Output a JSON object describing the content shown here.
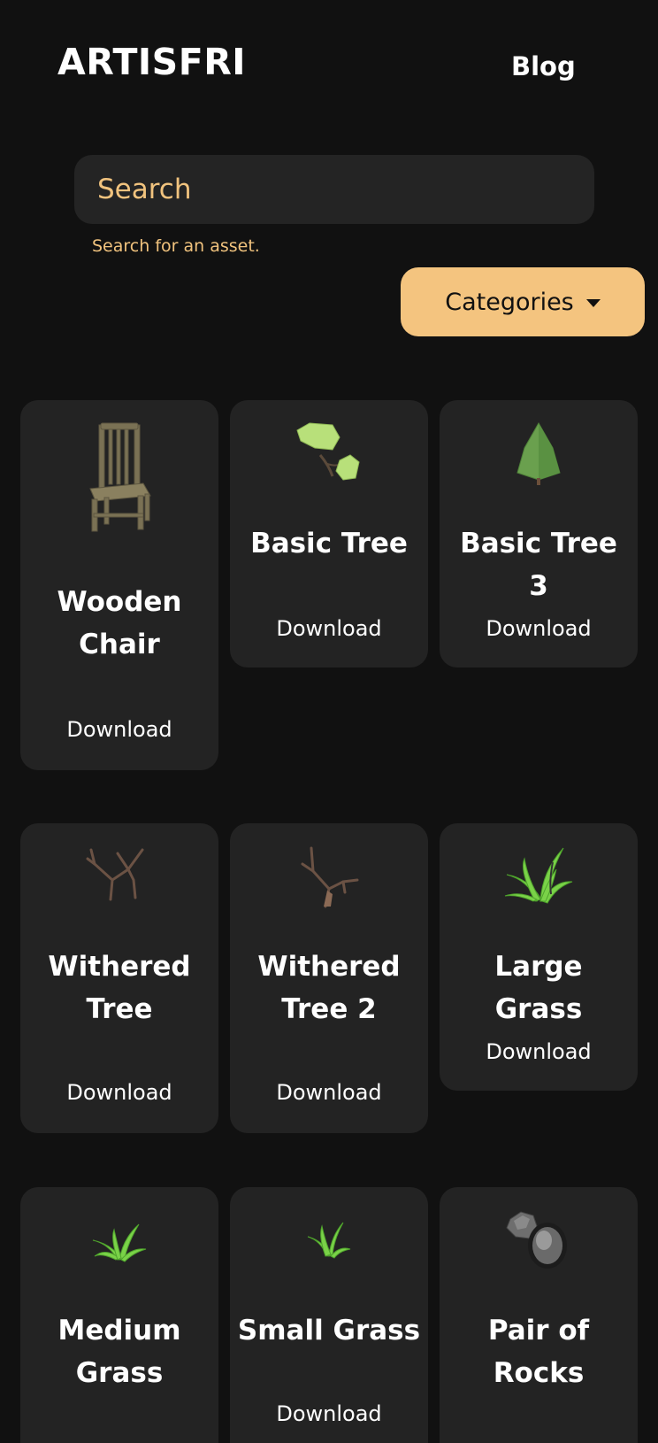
{
  "header": {
    "brand": "ARTISFRI",
    "blog_label": "Blog"
  },
  "search": {
    "placeholder": "Search",
    "value": "",
    "hint": "Search for an asset."
  },
  "categories": {
    "label": "Categories"
  },
  "assets": [
    {
      "title": "Wooden Chair",
      "download": "Download",
      "thumbnail": "wooden-chair-icon"
    },
    {
      "title": "Basic Tree",
      "download": "Download",
      "thumbnail": "basic-tree-icon"
    },
    {
      "title": "Basic Tree 3",
      "download": "Download",
      "thumbnail": "pine-tree-icon"
    },
    {
      "title": "Withered Tree",
      "download": "Download",
      "thumbnail": "withered-tree-icon"
    },
    {
      "title": "Withered Tree 2",
      "download": "Download",
      "thumbnail": "withered-tree-2-icon"
    },
    {
      "title": "Large Grass",
      "download": "Download",
      "thumbnail": "large-grass-icon"
    },
    {
      "title": "Medium Grass",
      "download": "",
      "thumbnail": "medium-grass-icon"
    },
    {
      "title": "Small Grass",
      "download": "Download",
      "thumbnail": "small-grass-icon"
    },
    {
      "title": "Pair of Rocks",
      "download": "",
      "thumbnail": "rocks-icon"
    }
  ],
  "colors": {
    "background": "#111111",
    "card": "#232323",
    "accent": "#f4c47f",
    "accent_text": "#f1c37e"
  }
}
